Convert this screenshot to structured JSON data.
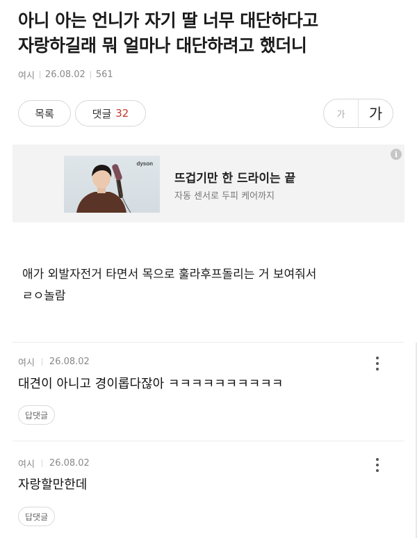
{
  "post": {
    "title_line1": "아니 아는 언니가 자기 딸 너무 대단하다고",
    "title_line2": "자랑하길래 뭐 얼마나 대단하려고 했더니",
    "author": "여시",
    "date": "26.08.02",
    "views": "561",
    "body_line1": "애가 외발자전거 타면서 목으로 훌라후프돌리는 거 보여줘서",
    "body_line2": "ㄹㅇ놀람"
  },
  "toolbar": {
    "list_label": "목록",
    "comment_label": "댓글",
    "comment_count": "32",
    "font_small": "가",
    "font_large": "가"
  },
  "ad": {
    "brand": "dyson",
    "title": "뜨겁기만 한 드라이는 끝",
    "subtitle": "자동 센서로 두피 케어까지",
    "info_glyph": "i"
  },
  "comments": [
    {
      "author": "여시",
      "date": "26.08.02",
      "text": "대견이 아니고 경이롭다잖아 ㅋㅋㅋㅋㅋㅋㅋㅋㅋㅋ",
      "reply_label": "답댓글"
    },
    {
      "author": "여시",
      "date": "26.08.02",
      "text": "자랑할만한데",
      "reply_label": "답댓글"
    }
  ],
  "colors": {
    "accent_count": "#c0392b",
    "ad_bg": "#f3f3f3"
  }
}
